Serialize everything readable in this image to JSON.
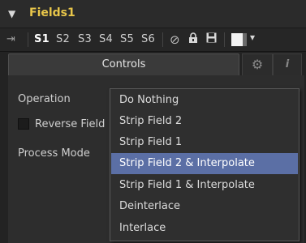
{
  "header": {
    "chevron_icon": "chevron-down-icon",
    "title": "Fields1"
  },
  "toolbar": {
    "pin_icon": "pin-icon",
    "slots": [
      "S1",
      "S2",
      "S3",
      "S4",
      "S5",
      "S6"
    ],
    "active_slot": "S1",
    "disable_icon": "disable-icon",
    "lock_icon": "lock-icon",
    "save_icon": "save-icon",
    "swatch_colors": [
      "#f3f3f3",
      "#6a6a6a"
    ]
  },
  "tabs": {
    "controls_label": "Controls",
    "settings_icon": "gear-icon",
    "info_icon": "info-icon"
  },
  "controls": {
    "operation_label": "Operation",
    "reverse_label": "Reverse Field",
    "reverse_checked": false,
    "process_mode_label": "Process Mode"
  },
  "dropdown": {
    "options": [
      "Do Nothing",
      "Strip Field 2",
      "Strip Field 1",
      "Strip Field 2 & Interpolate",
      "Strip Field 1 & Interpolate",
      "Deinterlace",
      "Interlace"
    ],
    "highlighted": "Strip Field 2 & Interpolate",
    "highlight_color": "#5b6fa5"
  },
  "colors": {
    "title": "#e8c64a",
    "background": "#232323"
  }
}
